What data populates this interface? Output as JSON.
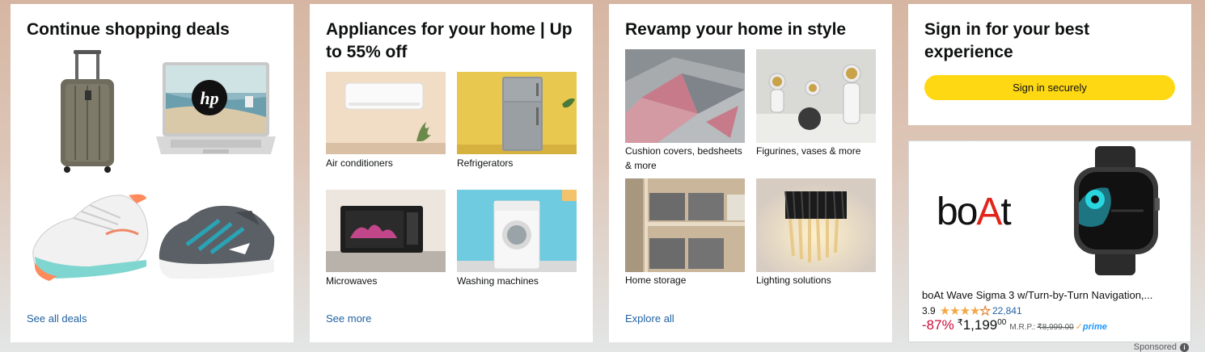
{
  "cards": [
    {
      "title": "Continue shopping deals",
      "link": "See all deals",
      "items": [
        {
          "icon": "suitcase-image"
        },
        {
          "icon": "laptop-image"
        },
        {
          "icon": "sneaker-image"
        },
        {
          "icon": "sports-shoe-image"
        }
      ]
    },
    {
      "title": "Appliances for your home | Up to 55% off",
      "link": "See more",
      "items": [
        {
          "label": "Air conditioners"
        },
        {
          "label": "Refrigerators"
        },
        {
          "label": "Microwaves"
        },
        {
          "label": "Washing machines"
        }
      ]
    },
    {
      "title": "Revamp your home in style",
      "link": "Explore all",
      "items": [
        {
          "label": "Cushion covers, bedsheets & more"
        },
        {
          "label": "Figurines, vases & more"
        },
        {
          "label": "Home storage"
        },
        {
          "label": "Lighting solutions"
        }
      ]
    }
  ],
  "signin": {
    "title": "Sign in for your best experience",
    "button": "Sign in securely"
  },
  "ad": {
    "brand_logo": "boAt",
    "product_title": "boAt Wave Sigma 3 w/Turn-by-Turn Navigation,...",
    "rating": "3.9",
    "stars": 3.9,
    "review_count": "22,841",
    "discount": "-87%",
    "currency": "₹",
    "price_whole": "1,199",
    "price_fraction": "00",
    "mrp_label": "M.R.P.:",
    "mrp_value": "₹8,999.00",
    "prime": "prime",
    "sponsored": "Sponsored"
  },
  "colors": {
    "link": "#2162a1",
    "signin_button": "#ffd814",
    "discount": "#cc0c39",
    "star": "#f3a847",
    "prime": "#1a98ff"
  }
}
